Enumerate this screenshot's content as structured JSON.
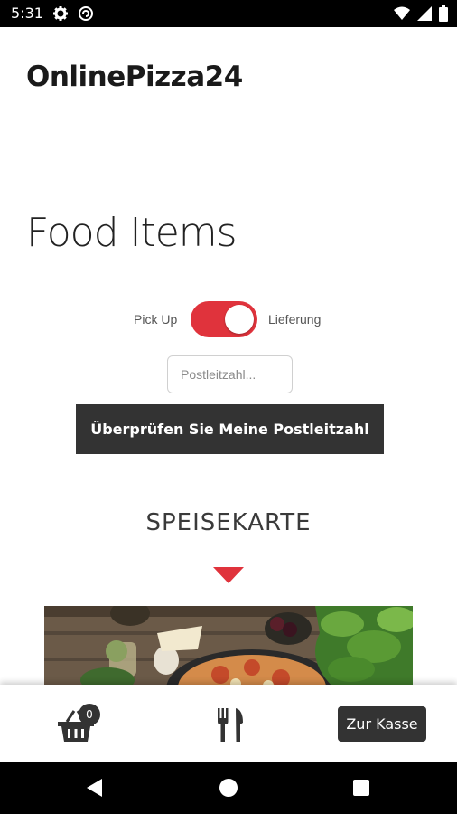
{
  "status_bar": {
    "time": "5:31",
    "left_icons": [
      "gear-icon",
      "sync-icon"
    ],
    "right_icons": [
      "wifi-icon",
      "cell-signal-icon",
      "battery-icon"
    ]
  },
  "header": {
    "app_title": "OnlinePizza24"
  },
  "main": {
    "heading": "Food Items",
    "delivery_toggle": {
      "left_label": "Pick Up",
      "right_label": "Lieferung",
      "selected": "Lieferung"
    },
    "zip_input": {
      "value": "",
      "placeholder": "Postleitzahl..."
    },
    "check_button_label": "Überprüfen Sie Meine Postleitzahl",
    "menu_heading": "SPEISEKARTE"
  },
  "bottom_bar": {
    "cart_count": "0",
    "checkout_label": "Zur Kasse"
  },
  "colors": {
    "accent": "#e0333c",
    "dark_button": "#333333"
  }
}
